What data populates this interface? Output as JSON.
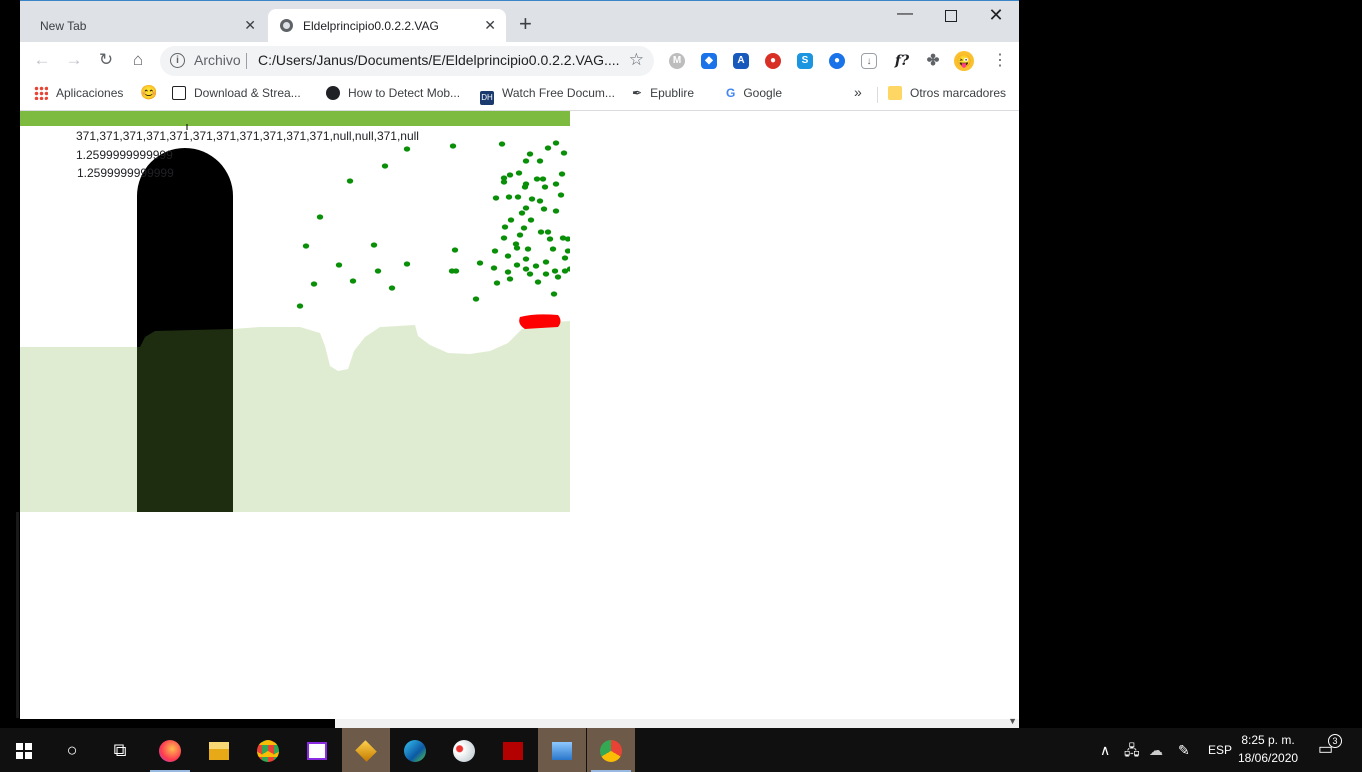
{
  "browser": {
    "tabs": [
      {
        "title": "New Tab",
        "close": "✕"
      },
      {
        "title": "Eldelprincipio0.0.2.2.VAG",
        "close": "✕"
      }
    ],
    "new_tab": "+",
    "window_controls": {
      "minimize": "—",
      "close": "✕"
    },
    "nav": {
      "back": "←",
      "forward": "→",
      "reload": "↻",
      "home": "⌂"
    },
    "omnibox": {
      "info_icon": "i",
      "chip": "Archivo",
      "url": "C:/Users/Janus/Documents/E/Eldelprincipio0.0.2.2.VAG....",
      "star": "☆"
    },
    "extensions": [
      "M",
      "◆",
      "A",
      "●",
      "S",
      "●",
      "↓",
      "f?",
      "✤"
    ],
    "profile": "😜",
    "menu": "⋮",
    "bookmarks": {
      "apps": "Aplicaciones",
      "smile": "😊",
      "items": [
        "Download & Strea...",
        "How to Detect Mob...",
        "Watch Free Docum...",
        "Epublire",
        "Google"
      ],
      "watch_icon": "DH",
      "epub_icon": "✒",
      "google_icon": "G",
      "more": "»",
      "others": "Otros marcadores"
    }
  },
  "page": {
    "readout_1": "371,371,371,371,371,371,371,371,371,371,371,null,null,371,null",
    "readout_2": "1.2599999999999",
    "readout_3": "1.2599999999999",
    "colors": {
      "top_bar": "#7cbb3f",
      "ground": "#e0ecd2",
      "pillar": "#000000",
      "pillar_overlap": "#1e2c0f",
      "leaves": "#0a8f08",
      "player": "#ff0000"
    }
  },
  "taskbar": {
    "start_icon": "windows-logo-icon",
    "cortana": "○",
    "taskview": "⧉",
    "apps": [
      "firefox-icon",
      "file-explorer-icon",
      "chrome-icon",
      "video-editor-icon",
      "winamp-icon",
      "edge-icon",
      "paint-icon",
      "flash-icon",
      "remote-desktop-icon",
      "chrome-canary-icon"
    ],
    "tray": {
      "up_arrow": "∧",
      "network": "🖧",
      "onedrive": "☁",
      "pen": "✎",
      "lang": "ESP"
    },
    "time": "8:25 p. m.",
    "date": "18/06/2020",
    "notifications": "3"
  }
}
